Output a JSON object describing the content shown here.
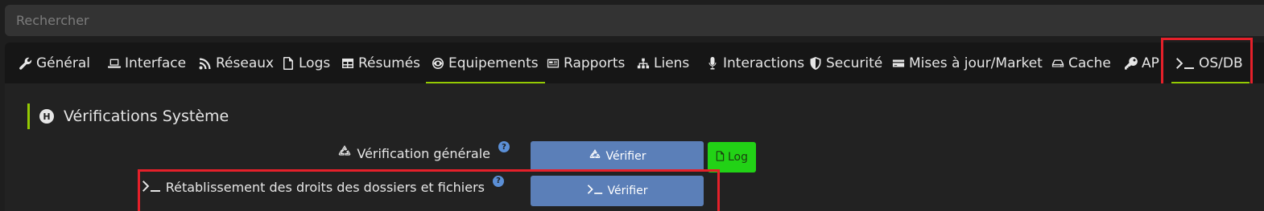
{
  "search": {
    "placeholder": "Rechercher"
  },
  "tabs": [
    {
      "label": "Général",
      "icon": "wrench-icon"
    },
    {
      "label": "Interface",
      "icon": "laptop-icon"
    },
    {
      "label": "Réseaux",
      "icon": "rss-icon"
    },
    {
      "label": "Logs",
      "icon": "file-icon"
    },
    {
      "label": "Résumés",
      "icon": "table-icon"
    },
    {
      "label": "Equipements",
      "icon": "eye-circle-icon"
    },
    {
      "label": "Rapports",
      "icon": "newspaper-icon"
    },
    {
      "label": "Liens",
      "icon": "sitemap-icon"
    },
    {
      "label": "Interactions",
      "icon": "microphone-icon"
    },
    {
      "label": "Securité",
      "icon": "shield-icon"
    },
    {
      "label": "Mises à jour/Market",
      "icon": "credit-card-icon"
    },
    {
      "label": "Cache",
      "icon": "hdd-icon"
    },
    {
      "label": "AP",
      "icon": "key-icon"
    },
    {
      "label": "OS/DB",
      "icon": "terminal-icon"
    }
  ],
  "active_tab": "OS/DB",
  "section": {
    "title": "Vérifications Système",
    "icon": "h-circle-icon"
  },
  "rows": [
    {
      "label": "Vérification générale",
      "label_icon": "recycle-icon",
      "help": "?",
      "button_label": "Vérifier",
      "button_icon": "recycle-icon",
      "log_label": "Log"
    },
    {
      "label": "Rétablissement des droits des dossiers et fichiers",
      "label_icon": "terminal-icon",
      "help": "?",
      "button_label": "Vérifier",
      "button_icon": "terminal-icon"
    }
  ],
  "colors": {
    "accent": "#94ca02",
    "highlight_box": "#e5202a",
    "primary_button": "#5b7fb8",
    "log_button": "#22d216",
    "help_icon": "#5b8fd6"
  }
}
